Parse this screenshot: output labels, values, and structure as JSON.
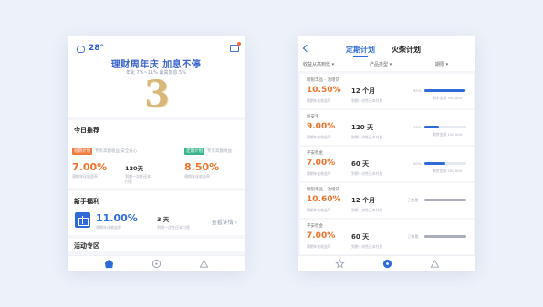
{
  "left_phone": {
    "weather": {
      "temp": "28°"
    },
    "hero": {
      "title": "理财周年庆  加息不停",
      "subtitle": "年化 7%~11%   最高加息 5%",
      "number": "3"
    },
    "recommend": {
      "title": "今日推荐",
      "items": [
        {
          "tag": "短期计划",
          "desc": "专享高额收益  安全省心",
          "rate": "7.00%",
          "rate_label": "预期年化收益率",
          "term": "120天",
          "term_label": "到期一次性还本付息"
        },
        {
          "tag": "定期计划",
          "desc": "专享高额收益",
          "rate": "8.50%",
          "rate_label": "预期年化收益率"
        }
      ]
    },
    "welfare": {
      "title": "新手福利",
      "rate": "11.00%",
      "rate_label": "预期年化收益率",
      "term": "3 天",
      "term_label": "到期一次性还本付息",
      "link": "查看详情  ›"
    },
    "activity": {
      "title": "活动专区"
    },
    "tabbar": [
      "home-icon",
      "compass-icon",
      "triangle-icon"
    ]
  },
  "right_phone": {
    "tabs": {
      "fixed": "定期计划",
      "fire": "火柴计划"
    },
    "filters": [
      "收益从高到低 ▾",
      "产品类型 ▾",
      "期限 ▾"
    ],
    "products": [
      {
        "name": "瑞银丰品 - 池增贷",
        "rate": "10.50%",
        "rate_label": "预期年化收益率",
        "term": "12 个月",
        "term_label": "到期一次性还本付息",
        "progress": 0.95,
        "percent": "95%",
        "remaining": "剩余金额 300,000"
      },
      {
        "name": "恒安宝",
        "rate": "9.00%",
        "rate_label": "预期年化收益率",
        "term": "120 天",
        "term_label": "到期一次性还本付息",
        "progress": 0.35,
        "percent": "35%",
        "remaining": "剩余金额 100,000"
      },
      {
        "name": "平安稳金",
        "rate": "7.00%",
        "rate_label": "预期年化收益率",
        "term": "60 天",
        "term_label": "到期一次性还本付息",
        "progress": 0.5,
        "percent": "50%",
        "remaining": "剩余金额 200,000"
      },
      {
        "name": "瑞银丰品 - 池增贷",
        "rate": "10.60%",
        "rate_label": "预期年化收益率",
        "term": "12 个月",
        "term_label": "到期一次性还本付息",
        "progress": 1.0,
        "percent": "已售罄",
        "remaining": "",
        "sold_out": true
      },
      {
        "name": "平安稳金",
        "rate": "7.00%",
        "rate_label": "预期年化收益率",
        "term": "60 天",
        "term_label": "到期一次性还本付息",
        "progress": 1.0,
        "percent": "已售罄",
        "remaining": "",
        "sold_out": true
      }
    ],
    "tabbar": [
      "star-icon",
      "compass-icon",
      "triangle-icon"
    ]
  }
}
